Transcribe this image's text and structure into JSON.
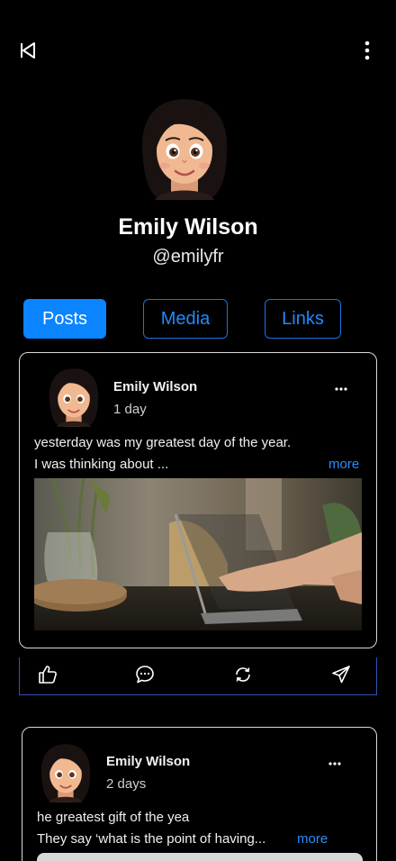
{
  "icons": {
    "back": "back-arrow-icon",
    "menu": "more-vertical-icon",
    "post_menu": "more-horizontal-icon",
    "like": "thumbs-up-icon",
    "comment": "comment-icon",
    "repost": "repost-icon",
    "share": "send-icon"
  },
  "colors": {
    "background": "#000000",
    "accent": "#0a84ff",
    "tab_outline": "#1f6fe0",
    "card_border": "#d9d9d9",
    "actions_border": "#2f54b8"
  },
  "profile": {
    "name": "Emily Wilson",
    "handle": "@emilyfr"
  },
  "tabs": [
    {
      "label": "Posts",
      "active": true
    },
    {
      "label": "Media",
      "active": false
    },
    {
      "label": "Links",
      "active": false
    }
  ],
  "posts": [
    {
      "author": "Emily Wilson",
      "time": "1 day",
      "line1": "yesterday was my greatest day of the year.",
      "line2": "I was thinking about ...",
      "more": "more"
    },
    {
      "author": "Emily Wilson",
      "time": "2 days",
      "line1": "he greatest gift of the  yea",
      "line2": "They say ‘what is the point of having...",
      "more": "more"
    }
  ]
}
